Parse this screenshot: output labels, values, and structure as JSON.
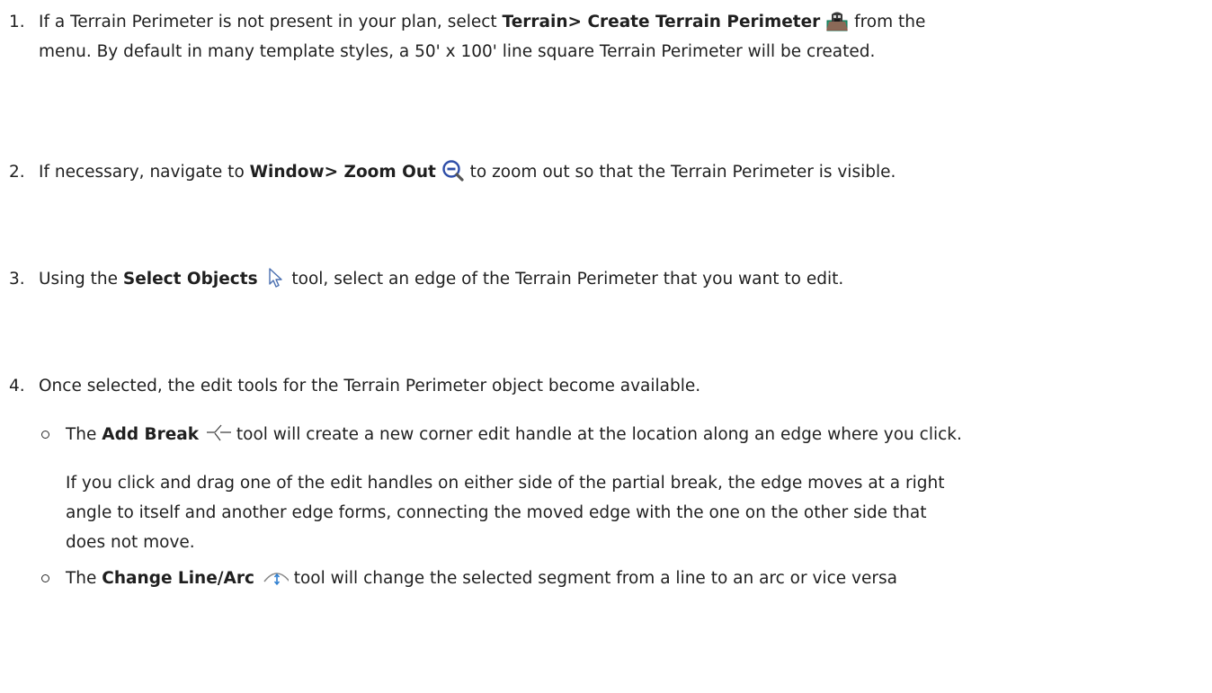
{
  "steps": [
    {
      "number": "1.",
      "pre": "If a Terrain Perimeter is not present in your plan, select ",
      "bold": "Terrain> Create Terrain Perimeter",
      "post_line1": " from the",
      "line2": "menu. By default in many template styles, a 50' x 100' line square Terrain Perimeter will be created."
    },
    {
      "number": "2.",
      "pre": "If necessary, navigate to ",
      "bold": "Window> Zoom Out",
      "post": " to zoom out so that the Terrain Perimeter is visible."
    },
    {
      "number": "3.",
      "pre": "Using the ",
      "bold": "Select Objects",
      "post": " tool, select an edge of the Terrain Perimeter that you want to edit."
    },
    {
      "number": "4.",
      "text": "Once selected, the edit tools for the Terrain Perimeter object become available."
    }
  ],
  "substeps": [
    {
      "pre": "The ",
      "bold": "Add Break",
      "post": " tool will create a new corner edit handle at the location along an edge where you click."
    },
    {
      "pre": "The ",
      "bold": "Change Line/Arc",
      "post": " tool will change the selected segment from a line to an arc or vice versa"
    }
  ],
  "break_paragraph": {
    "line1": "If you click and drag one of the edit handles on either side of the partial break, the edge moves at a right",
    "line2": "angle to itself and another edge forms, connecting the moved edge with the one on the other side that",
    "line3": "does not move."
  },
  "icons": [
    "terrain-perimeter-icon",
    "zoom-out-icon",
    "select-objects-icon",
    "add-break-icon",
    "change-line-arc-icon"
  ]
}
